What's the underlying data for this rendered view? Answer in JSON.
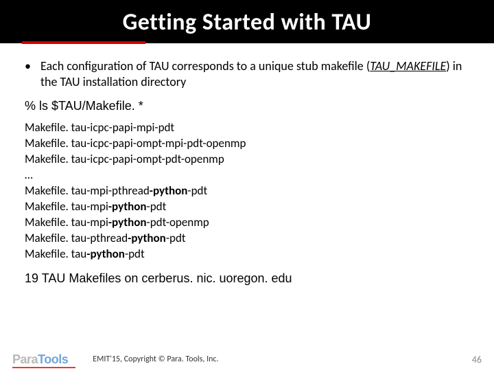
{
  "title": "Getting Started with TAU",
  "bullet": {
    "pre": "Each configuration of TAU corresponds to a unique stub makefile (",
    "var": "TAU_MAKEFILE",
    "post": ") in the TAU installation directory"
  },
  "command": "% ls $TAU/Makefile. *",
  "makefiles": [
    {
      "pre": "Makefile. tau-icpc-papi-mpi-pdt",
      "py": ""
    },
    {
      "pre": "Makefile. tau-icpc-papi-ompt-mpi-pdt-openmp",
      "py": ""
    },
    {
      "pre": "Makefile. tau-icpc-papi-ompt-pdt-openmp",
      "py": ""
    },
    {
      "pre": "…",
      "py": ""
    },
    {
      "pre": "Makefile. tau-mpi-pthread",
      "py": "-python",
      "post": "-pdt"
    },
    {
      "pre": "Makefile. tau-mpi",
      "py": "-python",
      "post": "-pdt"
    },
    {
      "pre": "Makefile. tau-mpi",
      "py": "-python",
      "post": "-pdt-openmp"
    },
    {
      "pre": "Makefile. tau-pthread",
      "py": "-python",
      "post": "-pdt"
    },
    {
      "pre": "Makefile. tau",
      "py": "-python",
      "post": "-pdt"
    }
  ],
  "summary": "19 TAU Makefiles on cerberus. nic. uoregon. edu",
  "footer": {
    "logo_para": "Para",
    "logo_tools": "Tools",
    "copyright": "EMIT'15, Copyright © Para. Tools, Inc.",
    "page": "46"
  }
}
